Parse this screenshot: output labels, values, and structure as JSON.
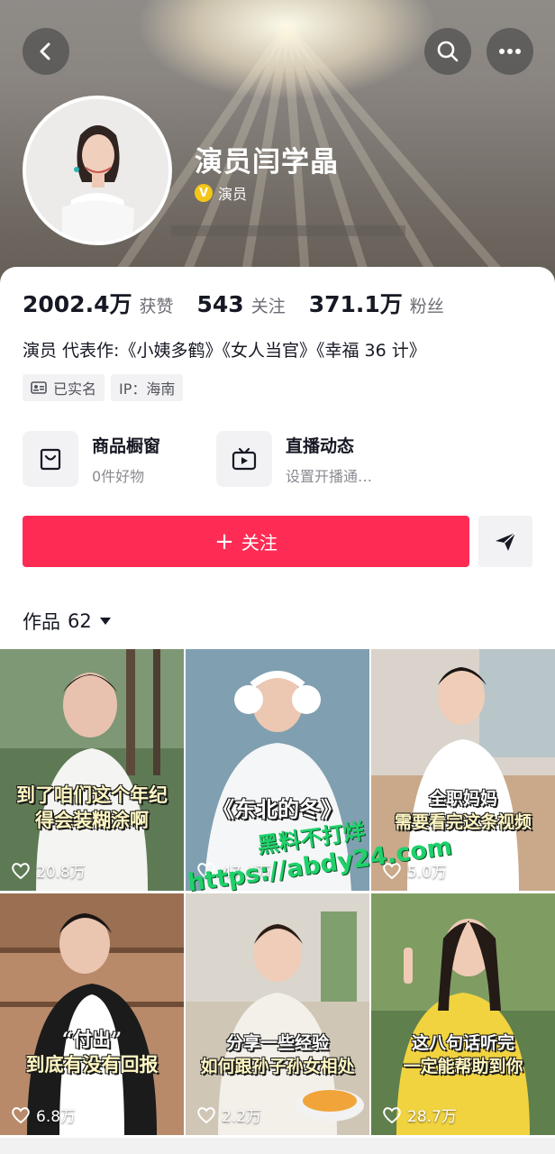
{
  "profile": {
    "name": "演员闫学晶",
    "verify_label": "演员",
    "verify_mark": "V"
  },
  "stats": [
    {
      "value": "2002.4万",
      "label": "获赞"
    },
    {
      "value": "543",
      "label": "关注"
    },
    {
      "value": "371.1万",
      "label": "粉丝"
    }
  ],
  "bio": "演员 代表作:《小姨多鹤》《女人当官》《幸福 36 计》",
  "tags": {
    "verified": "已实名",
    "ip": "IP：海南"
  },
  "features": {
    "shop_title": "商品橱窗",
    "shop_sub": "0件好物",
    "live_title": "直播动态",
    "live_sub": "设置开播通…"
  },
  "follow": {
    "plus": "+",
    "label": "关注"
  },
  "works": {
    "label": "作品",
    "count": "62"
  },
  "videos": [
    {
      "caption1": "到了咱们这个年纪",
      "caption2": "得会装糊涂啊",
      "likes": "20.8万"
    },
    {
      "caption1": "《东北的冬》",
      "caption2": "",
      "likes": "47.4万"
    },
    {
      "caption1": "全职妈妈",
      "caption2": "需要看完这条视频",
      "likes": "5.0万"
    },
    {
      "caption1": "“付出”",
      "caption2": "到底有没有回报",
      "likes": "6.8万"
    },
    {
      "caption1": "分享一些经验",
      "caption2": "如何跟孙子孙女相处",
      "likes": "2.2万"
    },
    {
      "caption1": "这八句话听完",
      "caption2": "一定能帮助到你",
      "likes": "28.7万"
    }
  ],
  "watermark": {
    "line1": "黑料不打烊",
    "line2": "https://abdy24.com"
  },
  "colors": {
    "accent": "#fe2c55",
    "verify_badge": "#f5c518",
    "watermark": "#1fd16a"
  },
  "icons": [
    "back-icon",
    "search-icon",
    "more-icon",
    "id-card-icon",
    "bag-icon",
    "tv-icon",
    "share-icon",
    "caret-down-icon",
    "heart-icon"
  ]
}
